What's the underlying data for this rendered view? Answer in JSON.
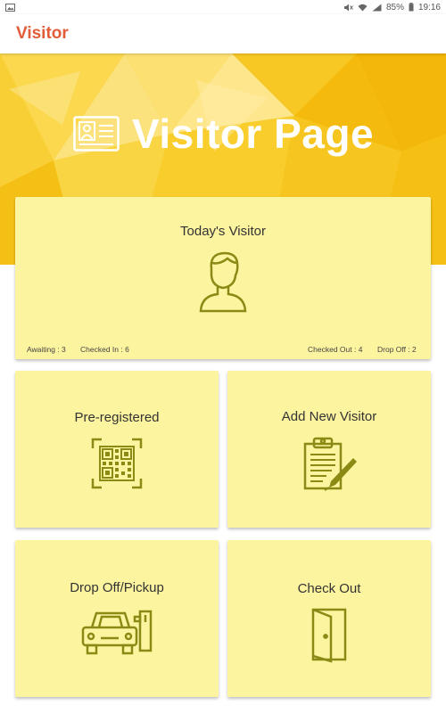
{
  "status_bar": {
    "battery": "85%",
    "time": "19:16"
  },
  "app_bar": {
    "title": "Visitor"
  },
  "hero": {
    "title": "Visitor Page",
    "icon": "id-card-icon"
  },
  "todays_visitor": {
    "title": "Today's Visitor",
    "icon": "person-icon",
    "stats": {
      "awaiting": "Awaiting : 3",
      "checked_in": "Checked In : 6",
      "checked_out": "Checked Out : 4",
      "drop_off": "Drop Off : 2"
    }
  },
  "tiles": [
    {
      "title": "Pre-registered",
      "icon": "qr-scan-icon"
    },
    {
      "title": "Add New Visitor",
      "icon": "clipboard-pen-icon"
    },
    {
      "title": "Drop Off/Pickup",
      "icon": "car-gate-icon"
    },
    {
      "title": "Check Out",
      "icon": "door-exit-icon"
    }
  ],
  "colors": {
    "accent": "#e25c3a",
    "hero_yellow": "#f6c51a",
    "card_bg": "#fdf4a0",
    "icon_olive": "#8a8a14"
  }
}
